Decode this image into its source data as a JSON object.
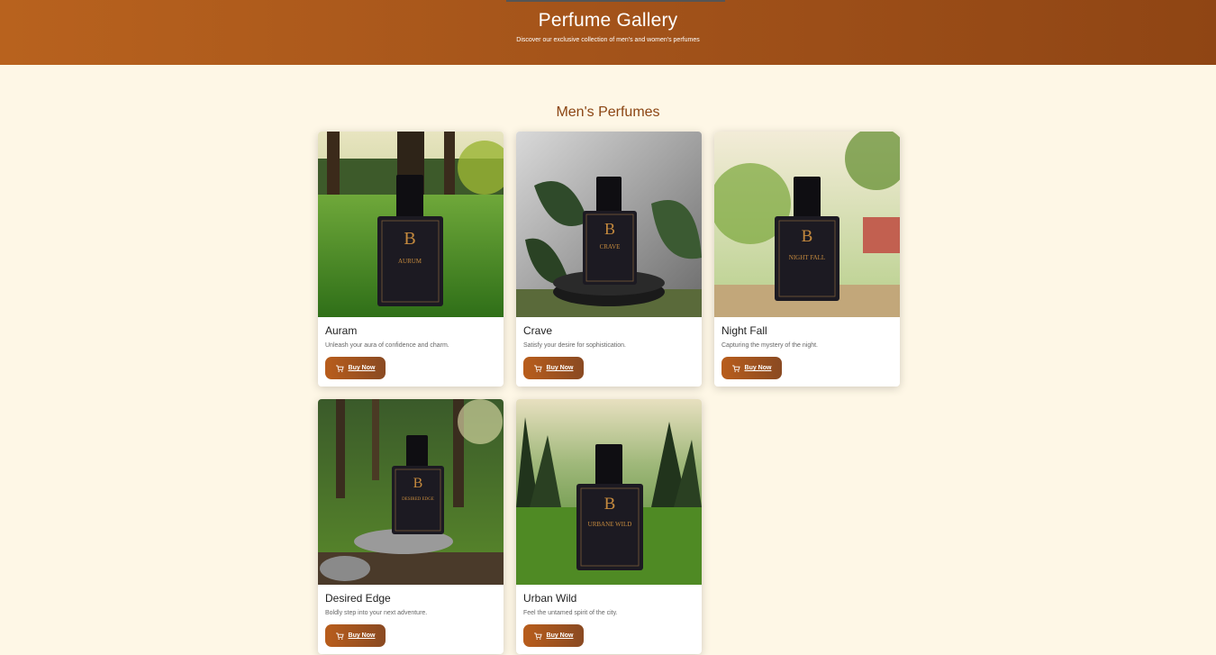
{
  "header": {
    "title": "Perfume Gallery",
    "subtitle": "Discover our exclusive collection of men's and women's perfumes"
  },
  "section": {
    "title": "Men's Perfumes"
  },
  "products": [
    {
      "name": "Auram",
      "description": "Unleash your aura of confidence and charm.",
      "button": "Buy Now",
      "bottle_label": "AURUM"
    },
    {
      "name": "Crave",
      "description": "Satisfy your desire for sophistication.",
      "button": "Buy Now",
      "bottle_label": "CRAVE"
    },
    {
      "name": "Night Fall",
      "description": "Capturing the mystery of the night.",
      "button": "Buy Now",
      "bottle_label": "NIGHT FALL"
    },
    {
      "name": "Desired Edge",
      "description": "Boldly step into your next adventure.",
      "button": "Buy Now",
      "bottle_label": "DESIRED EDGE"
    },
    {
      "name": "Urban Wild",
      "description": "Feel the untamed spirit of the city.",
      "button": "Buy Now",
      "bottle_label": "URBANE WILD"
    }
  ],
  "colors": {
    "header_start": "#b8621e",
    "header_end": "#8f4514",
    "accent": "#8b4513",
    "background": "#fef7e6"
  }
}
